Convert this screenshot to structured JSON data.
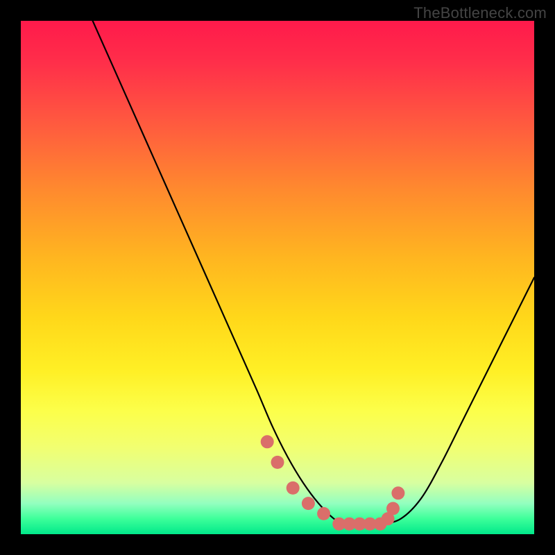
{
  "watermark": "TheBottleneck.com",
  "colors": {
    "dot_fill": "#da6e6a",
    "curve_stroke": "#000000",
    "frame_bg": "#000000"
  },
  "chart_data": {
    "type": "line",
    "title": "",
    "xlabel": "",
    "ylabel": "",
    "xlim": [
      0,
      100
    ],
    "ylim": [
      0,
      100
    ],
    "note": "Values read from visual gridless curve; y = 0 is bottom, y = 100 is top. The curve depicts a V/U-shaped profile with a flat bottom.",
    "series": [
      {
        "name": "curve",
        "x": [
          14,
          18,
          22,
          26,
          30,
          34,
          38,
          42,
          46,
          49,
          52,
          55,
          58,
          61,
          63,
          66,
          70,
          74,
          78,
          82,
          86,
          90,
          94,
          98,
          100
        ],
        "y": [
          100,
          91,
          82,
          73,
          64,
          55,
          46,
          37,
          28,
          21,
          15,
          10,
          6,
          3,
          2,
          2,
          2,
          3,
          7,
          14,
          22,
          30,
          38,
          46,
          50
        ]
      }
    ],
    "highlight_dots": {
      "name": "highlight",
      "x": [
        48,
        50,
        53,
        56,
        59,
        62,
        64,
        66,
        68,
        70,
        71.5,
        72.5,
        73.5
      ],
      "y": [
        18,
        14,
        9,
        6,
        4,
        2,
        2,
        2,
        2,
        2,
        3,
        5,
        8
      ]
    }
  }
}
